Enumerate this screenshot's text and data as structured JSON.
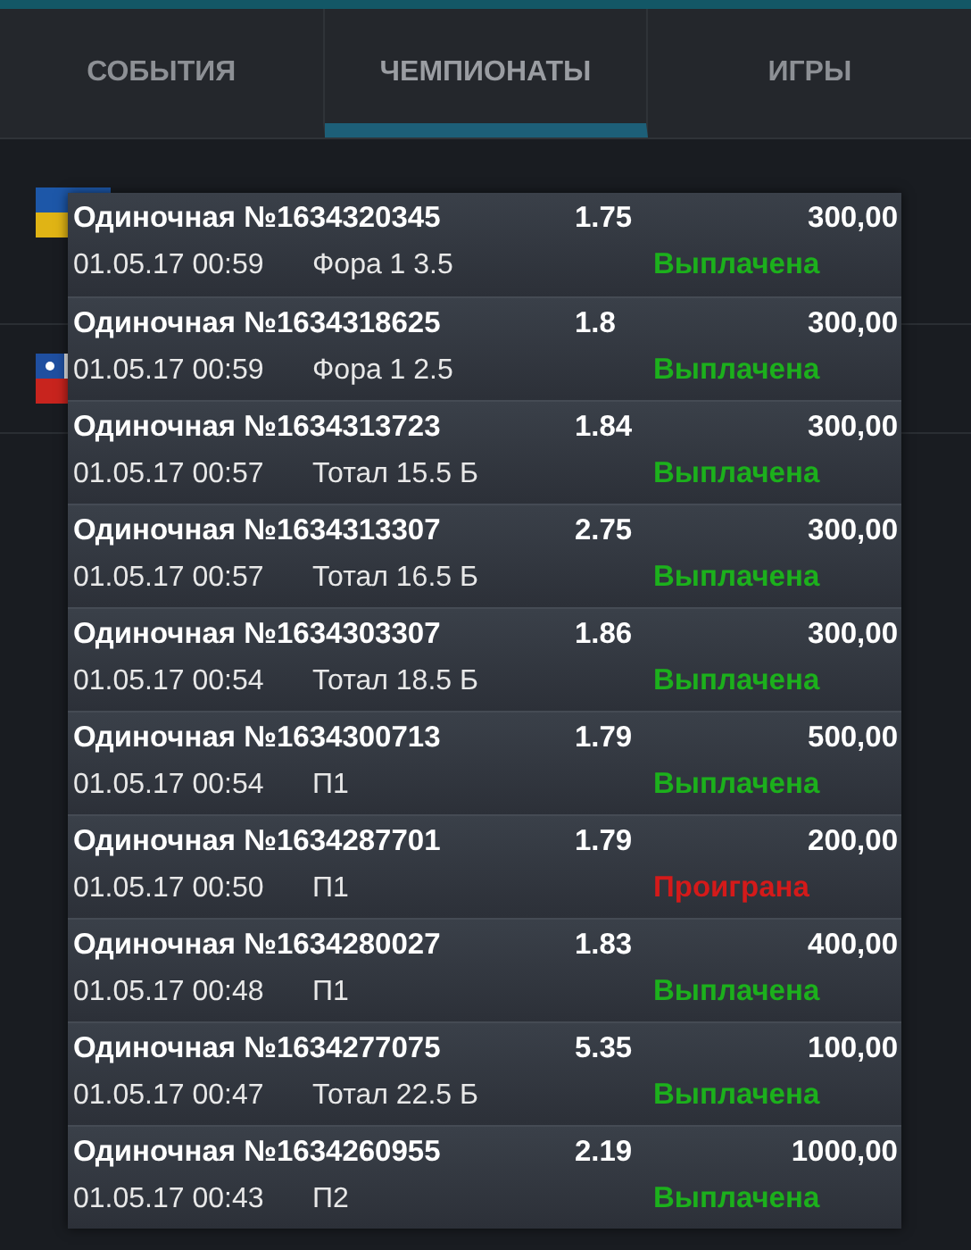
{
  "tabs": [
    {
      "label": "СОБЫТИЯ",
      "selected": false
    },
    {
      "label": "ЧЕМПИОНАТЫ",
      "selected": true
    },
    {
      "label": "ИГРЫ",
      "selected": false
    }
  ],
  "background_rows": [
    {
      "kind": "ukraine"
    },
    {
      "kind": "chile"
    }
  ],
  "bets": [
    {
      "title": "Одиночная №1634320345",
      "odds": "1.75",
      "amount": "300,00",
      "date": "01.05.17 00:59",
      "bet": "Фора 1 3.5",
      "status": "Выплачена",
      "color": "#1cb01c"
    },
    {
      "title": "Одиночная №1634318625",
      "odds": "1.8",
      "amount": "300,00",
      "date": "01.05.17 00:59",
      "bet": "Фора 1 2.5",
      "status": "Выплачена",
      "color": "#1cb01c"
    },
    {
      "title": "Одиночная №1634313723",
      "odds": "1.84",
      "amount": "300,00",
      "date": "01.05.17 00:57",
      "bet": "Тотал 15.5 Б",
      "status": "Выплачена",
      "color": "#1cb01c"
    },
    {
      "title": "Одиночная №1634313307",
      "odds": "2.75",
      "amount": "300,00",
      "date": "01.05.17 00:57",
      "bet": "Тотал 16.5 Б",
      "status": "Выплачена",
      "color": "#1cb01c"
    },
    {
      "title": "Одиночная №1634303307",
      "odds": "1.86",
      "amount": "300,00",
      "date": "01.05.17 00:54",
      "bet": "Тотал 18.5 Б",
      "status": "Выплачена",
      "color": "#1cb01c"
    },
    {
      "title": "Одиночная №1634300713",
      "odds": "1.79",
      "amount": "500,00",
      "date": "01.05.17 00:54",
      "bet": "П1",
      "status": "Выплачена",
      "color": "#1cb01c"
    },
    {
      "title": "Одиночная №1634287701",
      "odds": "1.79",
      "amount": "200,00",
      "date": "01.05.17 00:50",
      "bet": "П1",
      "status": "Проиграна",
      "color": "#d41a1a"
    },
    {
      "title": "Одиночная №1634280027",
      "odds": "1.83",
      "amount": "400,00",
      "date": "01.05.17 00:48",
      "bet": "П1",
      "status": "Выплачена",
      "color": "#1cb01c"
    },
    {
      "title": "Одиночная №1634277075",
      "odds": "5.35",
      "amount": "100,00",
      "date": "01.05.17 00:47",
      "bet": "Тотал 22.5 Б",
      "status": "Выплачена",
      "color": "#1cb01c"
    },
    {
      "title": "Одиночная №1634260955",
      "odds": "2.19",
      "amount": "1000,00",
      "date": "01.05.17 00:43",
      "bet": "П2",
      "status": "Выплачена",
      "color": "#1cb01c"
    }
  ]
}
